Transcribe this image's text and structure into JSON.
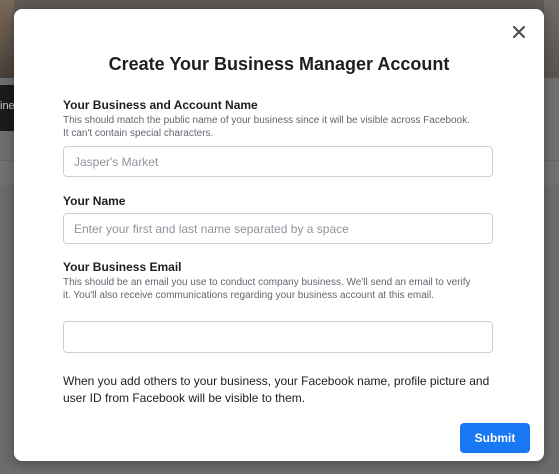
{
  "background": {
    "fragment_text": "ine"
  },
  "dialog": {
    "close_icon": "close-icon",
    "title": "Create Your Business Manager Account",
    "fields": [
      {
        "label": "Your Business and Account Name",
        "help": "This should match the public name of your business since it will be visible across Facebook. It can't contain special characters.",
        "value": "",
        "placeholder": "Jasper's Market"
      },
      {
        "label": "Your Name",
        "help": "",
        "value": "",
        "placeholder": "Enter your first and last name separated by a space"
      },
      {
        "label": "Your Business Email",
        "help": "This should be an email you use to conduct company business. We'll send an email to verify it. You'll also receive communications regarding your business account at this email.",
        "value": "",
        "placeholder": ""
      }
    ],
    "footer_note": "When you add others to your business, your Facebook name, profile picture and user ID from Facebook will be visible to them.",
    "submit_label": "Submit"
  },
  "colors": {
    "primary_button": "#1877f2",
    "overlay": "#6b6b6b"
  }
}
